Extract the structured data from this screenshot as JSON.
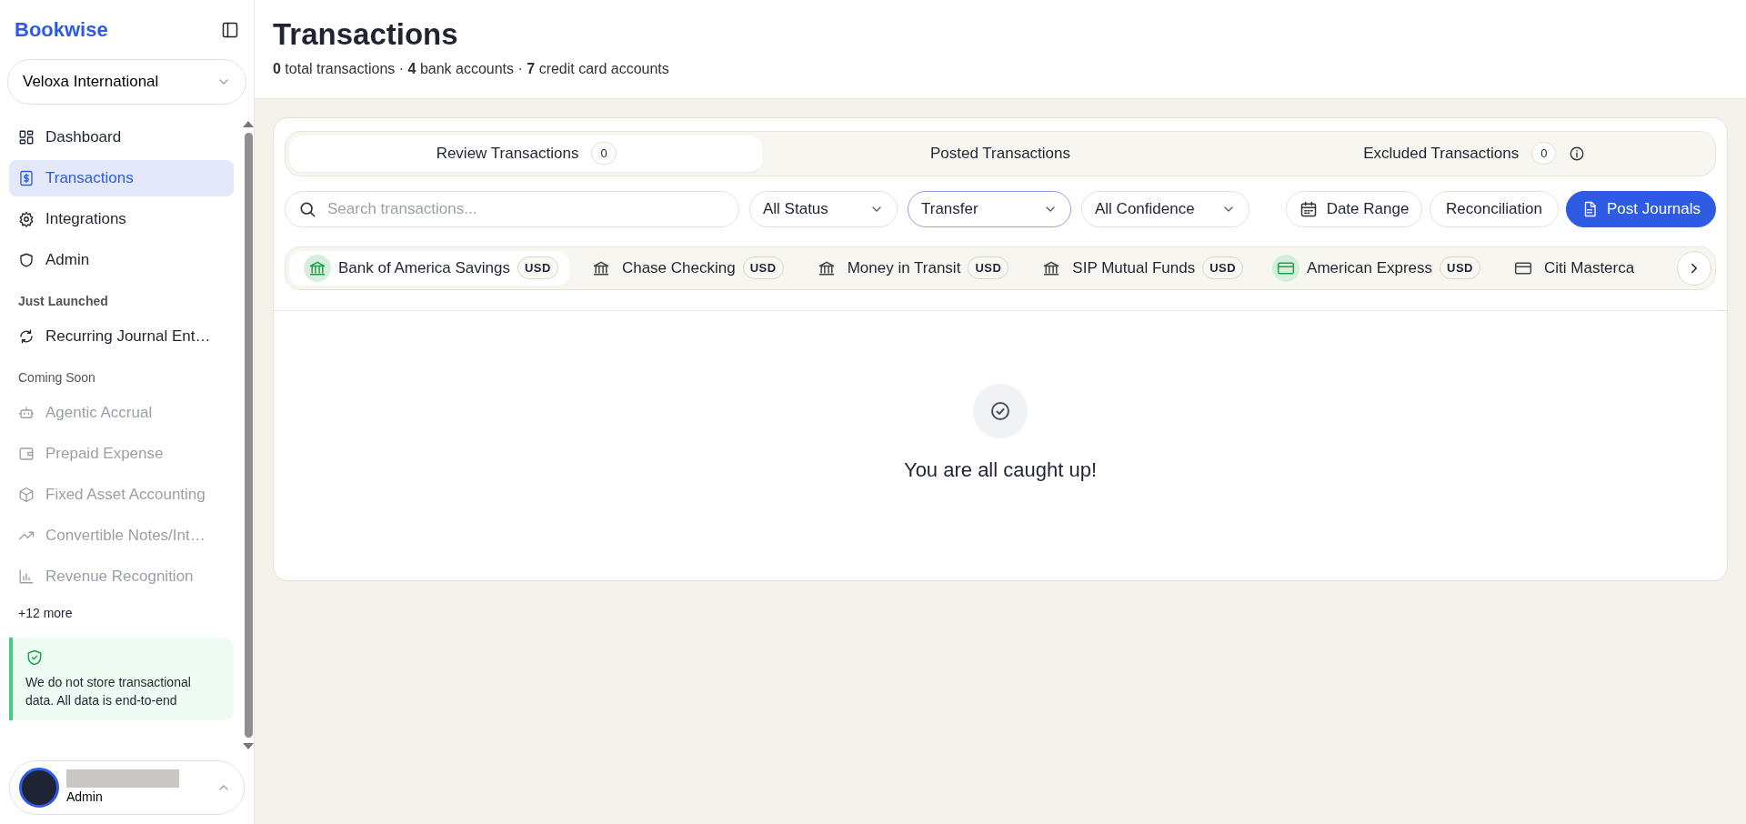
{
  "sidebar": {
    "brand": "Bookwise",
    "company": "Veloxa International",
    "nav": [
      {
        "label": "Dashboard",
        "selected": false
      },
      {
        "label": "Transactions",
        "selected": true
      },
      {
        "label": "Integrations",
        "selected": false
      },
      {
        "label": "Admin",
        "selected": false
      }
    ],
    "sections": [
      {
        "title": "Just Launched",
        "kind": "launched",
        "items": [
          {
            "label": "Recurring Journal Ent…"
          }
        ]
      },
      {
        "title": "Coming Soon",
        "kind": "soon",
        "items": [
          {
            "label": "Agentic Accrual"
          },
          {
            "label": "Prepaid Expense"
          },
          {
            "label": "Fixed Asset Accounting"
          },
          {
            "label": "Convertible Notes/Int…"
          },
          {
            "label": "Revenue Recognition"
          }
        ]
      }
    ],
    "more": "+12 more",
    "notice": "We do not store transactional data. All data is end-to-end",
    "user": {
      "role": "Admin"
    }
  },
  "header": {
    "title": "Transactions",
    "summary": "**0** total transactions · **4** bank accounts · **7** credit card accounts"
  },
  "tabs": [
    {
      "label": "Review Transactions",
      "count": "0",
      "selected": true,
      "info": false
    },
    {
      "label": "Posted Transactions",
      "selected": false,
      "info": false
    },
    {
      "label": "Excluded Transactions",
      "count": "0",
      "selected": false,
      "info": true
    }
  ],
  "filters": {
    "search": {
      "placeholder": "Search transactions..."
    },
    "dropdowns": [
      {
        "value": "All Status",
        "active": false
      },
      {
        "value": "Transfer",
        "active": true
      },
      {
        "value": "All Confidence",
        "active": false
      }
    ],
    "buttons": [
      {
        "label": "Date Range",
        "kind": "date"
      },
      {
        "label": "Reconciliation",
        "kind": "plain"
      },
      {
        "label": "Post Journals",
        "kind": "primary"
      }
    ]
  },
  "accounts": [
    {
      "name": "Bank of America Savings",
      "currency": "USD",
      "kind": "bank",
      "connected": true,
      "selected": true
    },
    {
      "name": "Chase Checking",
      "currency": "USD",
      "kind": "bank",
      "connected": false,
      "selected": false
    },
    {
      "name": "Money in Transit",
      "currency": "USD",
      "kind": "bank",
      "connected": false,
      "selected": false
    },
    {
      "name": "SIP Mutual Funds",
      "currency": "USD",
      "kind": "bank",
      "connected": false,
      "selected": false
    },
    {
      "name": "American Express",
      "currency": "USD",
      "kind": "card",
      "connected": true,
      "selected": false
    },
    {
      "name": "Citi Masterca",
      "kind": "card",
      "connected": false,
      "selected": false
    }
  ],
  "empty_state": {
    "message": "You are all caught up!"
  }
}
